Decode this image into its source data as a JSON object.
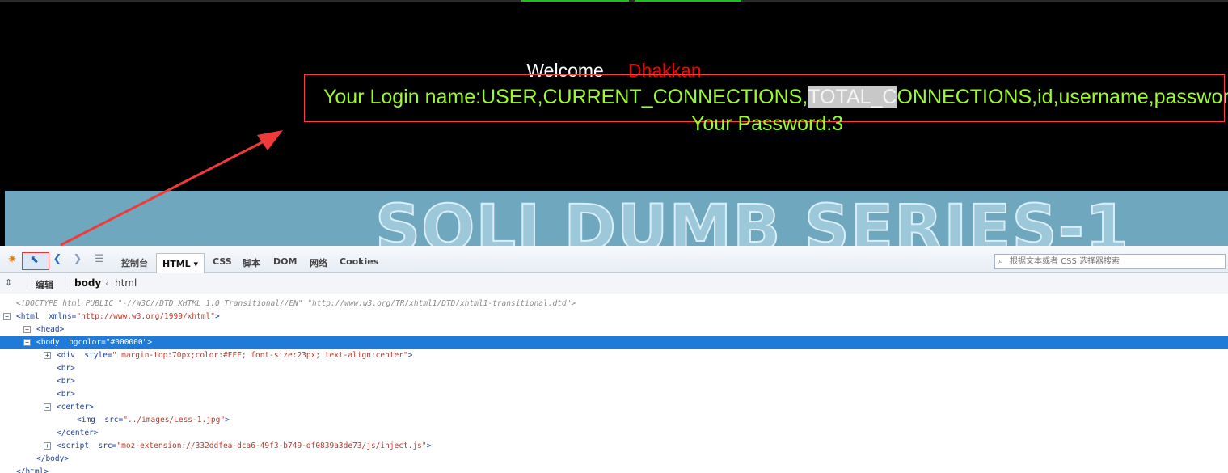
{
  "page": {
    "welcome": "Welcome",
    "username": "Dhakkan",
    "login_prefix": "Your Login name:USER,CURRENT_CONNECTIONS,",
    "login_highlight": "TOTAL_C",
    "login_suffix": "ONNECTIONS,id,username,password",
    "password_line": "Your Password:3",
    "banner_text": "SQLI DUMB SERIES-1"
  },
  "colors": {
    "page_bg": "#000000",
    "welcome_text": "#ffffff",
    "username_text": "#ff0000",
    "result_text": "#9afa2a",
    "highlight_box": "#ff3b3b",
    "selected_row": "#1f7ad8"
  },
  "devtools": {
    "toolbar": {
      "firebug_icon": "firebug-icon",
      "inspect_icon": "inspect-pointer-icon",
      "tabs": [
        "控制台",
        "HTML ▾",
        "CSS",
        "脚本",
        "DOM",
        "网络",
        "Cookies"
      ],
      "search_placeholder": "根据文本或者 CSS 选择器搜索"
    },
    "subbar": {
      "edit_label": "编辑",
      "breadcrumb": [
        "body",
        "‹",
        "html"
      ]
    },
    "tree": {
      "doctype": "<!DOCTYPE html PUBLIC \"-//W3C//DTD XHTML 1.0 Transitional//EN\" \"http://www.w3.org/TR/xhtml1/DTD/xhtml1-transitional.dtd\">",
      "html_open": "<html",
      "html_attr_name": "xmlns=",
      "html_attr_value": "\"http://www.w3.org/1999/xhtml\"",
      "html_close_bracket": ">",
      "head": "<head>",
      "body_open": "<body",
      "body_attr_name": "bgcolor=",
      "body_attr_value": "\"#000000\"",
      "body_close_bracket": ">",
      "div_open": "<div",
      "div_attr_name": "style=",
      "div_attr_value": "\" margin-top:70px;color:#FFF; font-size:23px; text-align:center\"",
      "div_close_bracket": ">",
      "br": "<br>",
      "center_open": "<center>",
      "img_open": "<img",
      "img_attr_name": "src=",
      "img_attr_value": "\"../images/Less-1.jpg\"",
      "img_close_bracket": ">",
      "center_close": "</center>",
      "script_open": "<script",
      "script_attr_name": "src=",
      "script_attr_value": "\"moz-extension://332ddfea-dca6-49f3-b749-df0839a3de73/js/inject.js\"",
      "script_close_bracket": ">",
      "body_close": "</body>",
      "html_close": "</html>",
      "expand_plus": "+",
      "expand_minus": "−"
    }
  }
}
